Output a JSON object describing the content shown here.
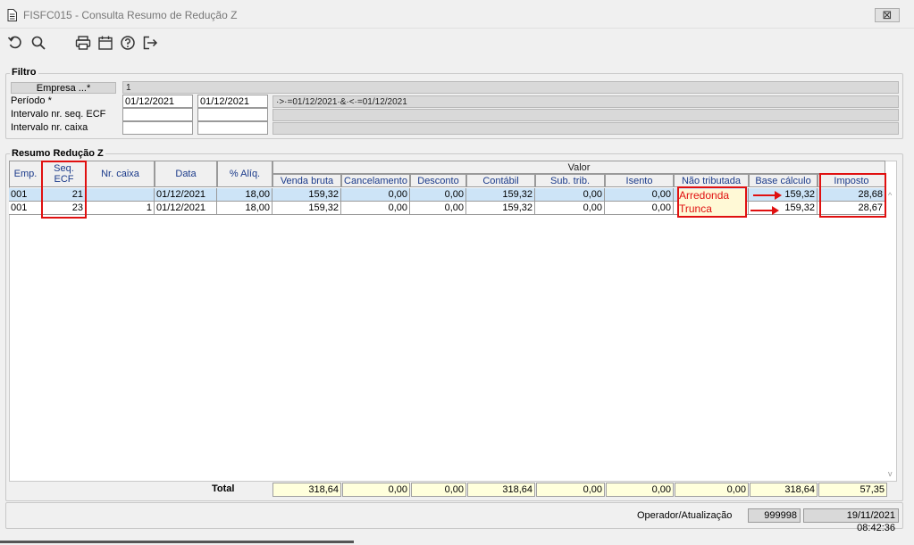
{
  "window": {
    "title": "FISFC015 - Consulta Resumo de Redução Z",
    "close_label": "⊠"
  },
  "toolbar": {
    "icons": [
      "undo-icon",
      "search-icon",
      "print-icon",
      "calendar-icon",
      "help-icon",
      "exit-icon"
    ]
  },
  "filtro": {
    "legend": "Filtro",
    "empresa_label": "Empresa ...*",
    "empresa_value": "1",
    "periodo_label": "Período *",
    "periodo_de": "01/12/2021",
    "periodo_ate": "01/12/2021",
    "periodo_expr": "·>·=01/12/2021·&·<·=01/12/2021",
    "seq_ecf_label": "Intervalo nr. seq. ECF",
    "caixa_label": "Intervalo nr. caixa"
  },
  "resumo": {
    "legend": "Resumo Redução Z",
    "headers": {
      "emp": "Emp.",
      "seq_ecf": "Seq. ECF",
      "nr_caixa": "Nr. caixa",
      "data": "Data",
      "aliq": "% Alíq.",
      "valor": "Valor",
      "venda_bruta": "Venda bruta",
      "cancelamento": "Cancelamento",
      "desconto": "Desconto",
      "contabil": "Contábil",
      "sub_trib": "Sub. trib.",
      "isento": "Isento",
      "nao_tributada": "Não tributada",
      "base_calculo": "Base cálculo",
      "imposto": "Imposto"
    },
    "rows": [
      {
        "emp": "001",
        "seq_ecf": "21",
        "nr_caixa": "",
        "data": "01/12/2021",
        "aliq": "18,00",
        "venda_bruta": "159,32",
        "cancelamento": "0,00",
        "desconto": "0,00",
        "contabil": "159,32",
        "sub_trib": "0,00",
        "isento": "0,00",
        "nao_tributada": "",
        "base_calculo": "159,32",
        "imposto": "28,68"
      },
      {
        "emp": "001",
        "seq_ecf": "23",
        "nr_caixa": "1",
        "data": "01/12/2021",
        "aliq": "18,00",
        "venda_bruta": "159,32",
        "cancelamento": "0,00",
        "desconto": "0,00",
        "contabil": "159,32",
        "sub_trib": "0,00",
        "isento": "0,00",
        "nao_tributada": "",
        "base_calculo": "159,32",
        "imposto": "28,67"
      }
    ],
    "annotations": {
      "row1": "Arredonda",
      "row2": "Trunca"
    },
    "totals": {
      "label": "Total",
      "venda_bruta": "318,64",
      "cancelamento": "0,00",
      "desconto": "0,00",
      "contabil": "318,64",
      "sub_trib": "0,00",
      "isento": "0,00",
      "nao_tributada": "0,00",
      "base_calculo": "318,64",
      "imposto": "57,35"
    }
  },
  "footer": {
    "operador_label": "Operador/Atualização",
    "operador": "999998",
    "atualizacao": "19/11/2021 08:42:36"
  },
  "colors": {
    "annotation": "#e01010",
    "selected_row": "#cde4f7",
    "totals_bg": "#ffffdc"
  }
}
